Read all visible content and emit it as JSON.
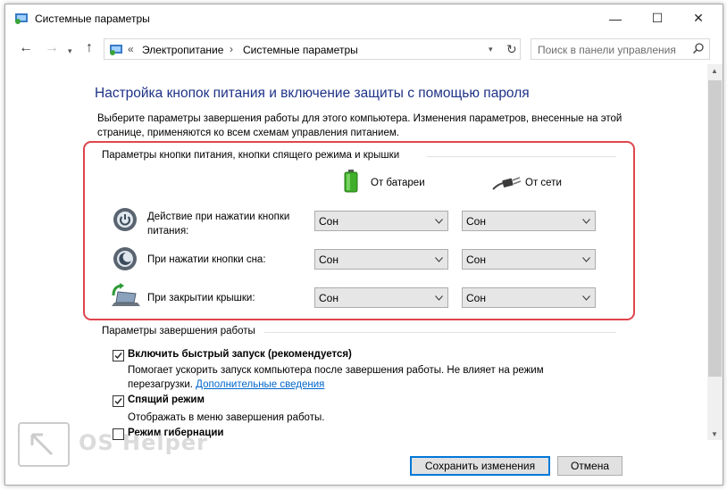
{
  "window": {
    "title": "Системные параметры",
    "minimize": "—",
    "maximize": "☐",
    "close": "✕"
  },
  "nav": {
    "back": "←",
    "forward": "→",
    "dropdown": "▾",
    "up": "↑",
    "breadcrumb_sep": "«",
    "crumbs": [
      "Электропитание",
      "Системные параметры"
    ],
    "crumb_sep": "›",
    "address_dropdown": "▾",
    "refresh": "↻",
    "search_placeholder": "Поиск в панели управления"
  },
  "page": {
    "heading": "Настройка кнопок питания и включение защиты с помощью пароля",
    "description": "Выберите параметры завершения работы для этого компьютера. Изменения параметров, внесенные на этой странице, применяются ко всем схемам управления питанием."
  },
  "buttons_section": {
    "label": "Параметры кнопки питания, кнопки спящего режима и крышки",
    "col_battery": "От батареи",
    "col_ac": "От сети",
    "rows": [
      {
        "label": "Действие при нажатии кнопки питания:",
        "battery": "Сон",
        "ac": "Сон"
      },
      {
        "label": "При нажатии кнопки сна:",
        "battery": "Сон",
        "ac": "Сон"
      },
      {
        "label": "При закрытии крышки:",
        "battery": "Сон",
        "ac": "Сон"
      }
    ]
  },
  "shutdown_section": {
    "label": "Параметры завершения работы",
    "options": [
      {
        "label": "Включить быстрый запуск (рекомендуется)",
        "checked": true,
        "desc_line1": "Помогает ускорить запуск компьютера после завершения работы. Не влияет на режим",
        "desc_line2": "перезагрузки.",
        "link": "Дополнительные сведения"
      },
      {
        "label": "Спящий режим",
        "checked": true,
        "desc_line1": "Отображать в меню завершения работы."
      },
      {
        "label": "Режим гибернации",
        "checked": false
      }
    ]
  },
  "footer": {
    "save": "Сохранить изменения",
    "cancel": "Отмена"
  },
  "watermark": {
    "text": "OS Helper"
  },
  "colors": {
    "heading": "#1e3287",
    "link": "#0066cc",
    "highlight": "#e0454d"
  }
}
